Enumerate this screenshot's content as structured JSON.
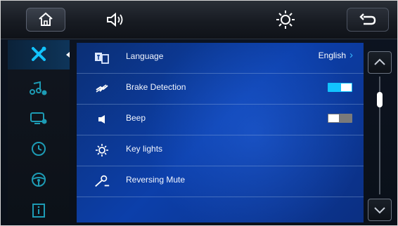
{
  "topbar": {
    "icons": [
      "home-icon",
      "volume-icon",
      "brightness-icon",
      "back-icon"
    ]
  },
  "sidebar": {
    "items": [
      {
        "icon": "settings-tools-icon",
        "active": true
      },
      {
        "icon": "audio-settings-icon",
        "active": false
      },
      {
        "icon": "display-settings-icon",
        "active": false
      },
      {
        "icon": "clock-icon",
        "active": false
      },
      {
        "icon": "steering-wheel-icon",
        "active": false
      },
      {
        "icon": "info-icon",
        "active": false
      }
    ]
  },
  "settings": {
    "language": {
      "label": "Language",
      "value": "English",
      "icon": "language-icon"
    },
    "brake_detection": {
      "label": "Brake Detection",
      "state": "on",
      "icon": "brake-detection-icon"
    },
    "beep": {
      "label": "Beep",
      "state": "off",
      "icon": "beep-icon"
    },
    "key_lights": {
      "label": "Key lights",
      "icon": "key-lights-icon"
    },
    "reversing_mute": {
      "label": "Reversing Mute",
      "icon": "reversing-mute-icon"
    }
  },
  "scroll": {
    "position": 0.12
  },
  "colors": {
    "accent": "#12c3ff",
    "panel": "#0c3faa",
    "sidebar_active": "#0e355a"
  }
}
